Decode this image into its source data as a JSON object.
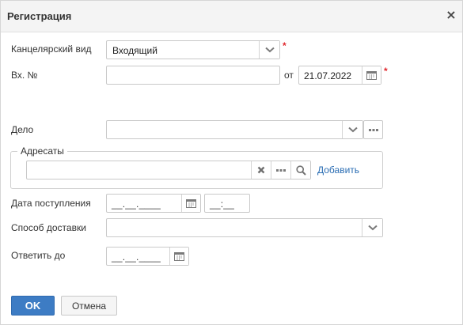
{
  "dialog": {
    "title": "Регистрация",
    "close_glyph": "×"
  },
  "form": {
    "office_type": {
      "label": "Канцелярский вид",
      "value": "Входящий",
      "required_mark": "*"
    },
    "incoming_no": {
      "label": "Вх. №",
      "value": "",
      "from_label": "от",
      "date": "21.07.2022",
      "required_mark": "*"
    },
    "case": {
      "label": "Дело",
      "value": ""
    },
    "addressees": {
      "legend": "Адресаты",
      "value": "",
      "add_link": "Добавить"
    },
    "receipt_date": {
      "label": "Дата поступления",
      "date_mask": "__.__.____",
      "time_mask": "__:__"
    },
    "delivery_method": {
      "label": "Способ доставки",
      "value": ""
    },
    "reply_by": {
      "label": "Ответить до",
      "date_mask": "__.__.____"
    }
  },
  "footer": {
    "ok_label": "OK",
    "cancel_label": "Отмена"
  },
  "colors": {
    "primary": "#3d7cc4",
    "required": "#e0282e",
    "link": "#2a6db3"
  },
  "icons": [
    "close-icon",
    "chevron-down-icon",
    "calendar-icon",
    "more-icon",
    "clear-icon",
    "search-icon"
  ]
}
